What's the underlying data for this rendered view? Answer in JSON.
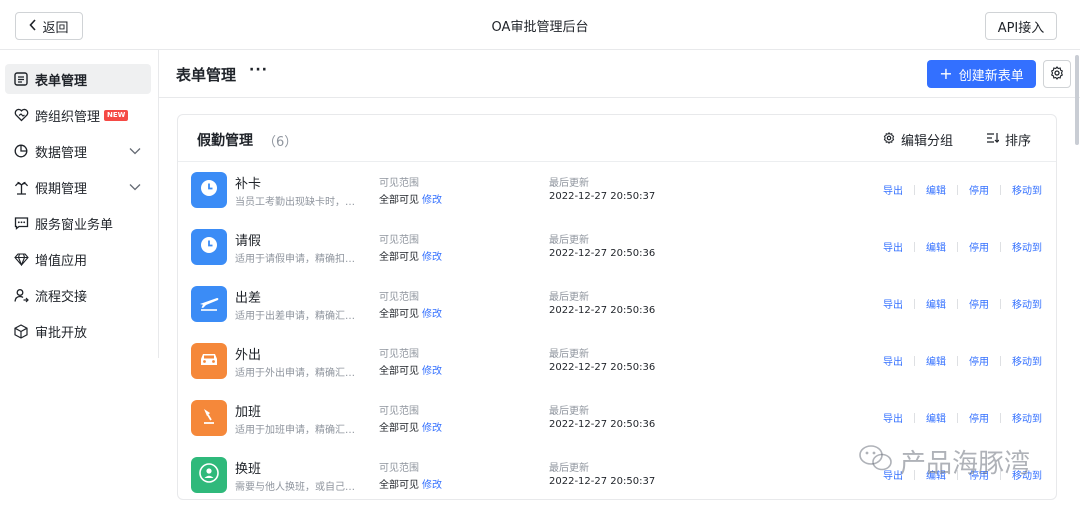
{
  "topbar": {
    "back_label": "返回",
    "title": "OA审批管理后台",
    "api_label": "API接入"
  },
  "sidebar": {
    "items": [
      {
        "label": "表单管理",
        "icon": "form-icon",
        "active": true
      },
      {
        "label": "跨组织管理",
        "icon": "heart-link-icon",
        "badge": "NEW"
      },
      {
        "label": "数据管理",
        "icon": "pie-chart-icon",
        "caret": true
      },
      {
        "label": "假期管理",
        "icon": "palm-tree-icon",
        "caret": true
      },
      {
        "label": "服务窗业务单",
        "icon": "chat-dots-icon"
      },
      {
        "label": "增值应用",
        "icon": "diamond-icon"
      },
      {
        "label": "流程交接",
        "icon": "user-transfer-icon"
      },
      {
        "label": "审批开放",
        "icon": "cube-icon"
      }
    ]
  },
  "header": {
    "title": "表单管理",
    "more": "···",
    "create_label": "创建新表单",
    "accent": "#3370ff"
  },
  "group": {
    "title": "假勤管理",
    "count": "（6）",
    "edit_group_label": "编辑分组",
    "sort_label": "排序"
  },
  "labels": {
    "visible_range": "可见范围",
    "visible_all": "全部可见",
    "modify": "修改",
    "last_updated": "最后更新",
    "export": "导出",
    "edit": "编辑",
    "disable": "停用",
    "move_to": "移动到"
  },
  "forms": [
    {
      "name": "补卡",
      "desc": "当员工考勤出现缺卡时，…",
      "updated": "2022-12-27 20:50:37",
      "color": "#3b8cf6",
      "icon": "clock-icon"
    },
    {
      "name": "请假",
      "desc": "适用于请假申请，精确扣…",
      "updated": "2022-12-27 20:50:36",
      "color": "#3b8cf6",
      "icon": "clock-icon"
    },
    {
      "name": "出差",
      "desc": "适用于出差申请，精确汇…",
      "updated": "2022-12-27 20:50:36",
      "color": "#3b8cf6",
      "icon": "plane-icon"
    },
    {
      "name": "外出",
      "desc": "适用于外出申请，精确汇…",
      "updated": "2022-12-27 20:50:36",
      "color": "#f5883a",
      "icon": "car-icon"
    },
    {
      "name": "加班",
      "desc": "适用于加班申请，精确汇…",
      "updated": "2022-12-27 20:50:36",
      "color": "#f5883a",
      "icon": "desk-lamp-icon"
    },
    {
      "name": "换班",
      "desc": "需要与他人换班，或自己…",
      "updated": "2022-12-27 20:50:37",
      "color": "#2fb97b",
      "icon": "user-swap-icon"
    }
  ],
  "watermark": {
    "text": "产品海豚湾"
  }
}
